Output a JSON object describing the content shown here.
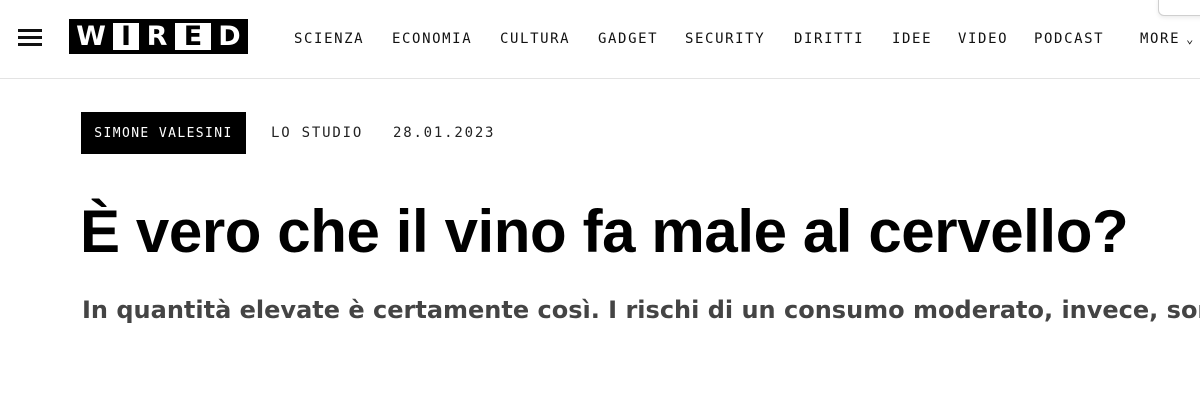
{
  "header": {
    "menu_icon": "hamburger-menu-icon",
    "logo": {
      "letters": [
        "W",
        "I",
        "R",
        "E",
        "D"
      ],
      "text": "WIRED"
    },
    "nav": [
      {
        "label": "SCIENZA"
      },
      {
        "label": "ECONOMIA"
      },
      {
        "label": "CULTURA"
      },
      {
        "label": "GADGET"
      },
      {
        "label": "SECURITY"
      },
      {
        "label": "DIRITTI"
      },
      {
        "label": "IDEE"
      },
      {
        "label": "VIDEO"
      },
      {
        "label": "PODCAST"
      }
    ],
    "more": {
      "label": "MORE",
      "icon": "chevron-down-icon"
    }
  },
  "article": {
    "author": "SIMONE VALESINI",
    "section": "LO STUDIO",
    "date": "28.01.2023",
    "title": "È vero che il vino fa male al cervello?",
    "subtitle": "In quantità elevate è certamente così. I rischi di un consumo moderato, invece, sono u"
  },
  "colors": {
    "background": "#ffffff",
    "text": "#000000",
    "subtitle": "#444444",
    "tag_background": "#000000",
    "tag_text": "#ffffff"
  }
}
